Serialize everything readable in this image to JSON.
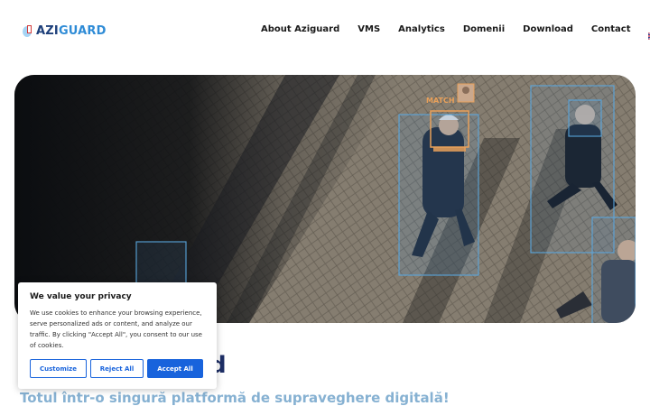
{
  "brand": {
    "logo_part1": "AZI",
    "logo_part2": "GUARD"
  },
  "nav": {
    "items": [
      {
        "label": "About Aziguard"
      },
      {
        "label": "VMS"
      },
      {
        "label": "Analytics"
      },
      {
        "label": "Domenii"
      },
      {
        "label": "Download"
      },
      {
        "label": "Contact"
      }
    ],
    "language_flag": "uk-flag-icon"
  },
  "hero": {
    "match_label": "MATCH",
    "title_visible": "d",
    "subtitle": "Totul într-o singură platformă de supraveghere digitală!"
  },
  "cookie_banner": {
    "title": "We value your privacy",
    "text": "We use cookies to enhance your browsing experience, serve personalized ads or content, and analyze our traffic. By clicking \"Accept All\", you consent to our use of cookies.",
    "customize_label": "Customize",
    "reject_label": "Reject All",
    "accept_label": "Accept All"
  },
  "colors": {
    "accent": "#1863dc",
    "title": "#1e2f66",
    "subtitle": "#86b1d2",
    "match": "#e8a05a"
  }
}
